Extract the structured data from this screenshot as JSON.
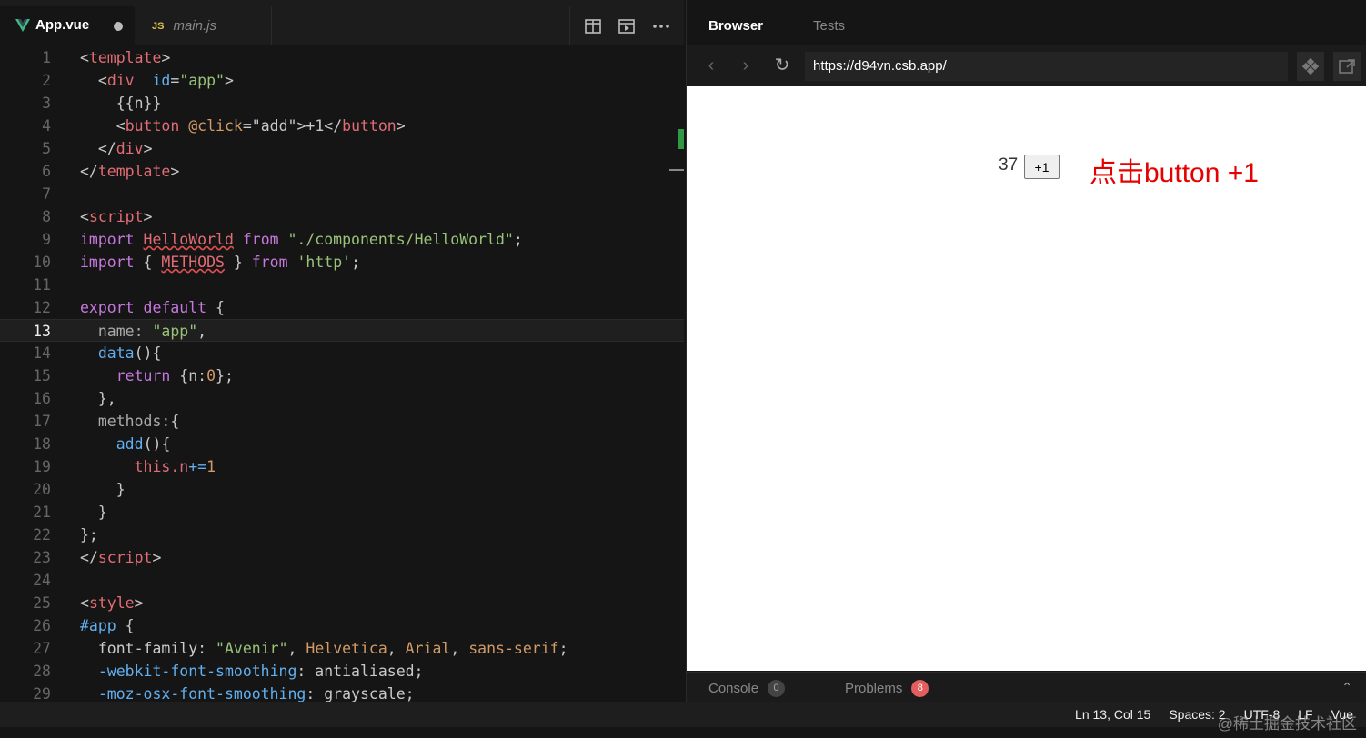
{
  "editor": {
    "tabs": [
      {
        "label": "App.vue",
        "icon": "vue-logo-icon",
        "modified": true
      },
      {
        "label": "main.js",
        "badge": "JS"
      }
    ],
    "actions": [
      "split-editor-icon",
      "preview-icon",
      "more-icon"
    ],
    "current_line": 13,
    "lines": [
      {
        "n": "1"
      },
      {
        "n": "2"
      },
      {
        "n": "3"
      },
      {
        "n": "4"
      },
      {
        "n": "5"
      },
      {
        "n": "6"
      },
      {
        "n": "7"
      },
      {
        "n": "8"
      },
      {
        "n": "9"
      },
      {
        "n": "10"
      },
      {
        "n": "11"
      },
      {
        "n": "12"
      },
      {
        "n": "13"
      },
      {
        "n": "14"
      },
      {
        "n": "15"
      },
      {
        "n": "16"
      },
      {
        "n": "17"
      },
      {
        "n": "18"
      },
      {
        "n": "19"
      },
      {
        "n": "20"
      },
      {
        "n": "21"
      },
      {
        "n": "22"
      },
      {
        "n": "23"
      },
      {
        "n": "24"
      },
      {
        "n": "25"
      },
      {
        "n": "26"
      },
      {
        "n": "27"
      },
      {
        "n": "28"
      },
      {
        "n": "29"
      }
    ],
    "code": [
      [
        [
          "t-br",
          "<"
        ],
        [
          "t-tag",
          "template"
        ],
        [
          "t-br",
          ">"
        ]
      ],
      [
        [
          "",
          "  "
        ],
        [
          "t-br",
          "<"
        ],
        [
          "t-tag",
          "div"
        ],
        [
          "",
          "",
          " "
        ],
        [
          "t-attr",
          " id"
        ],
        [
          "t-br",
          "="
        ],
        [
          "t-str",
          "\"app\""
        ],
        [
          "t-br",
          ">"
        ]
      ],
      [
        [
          "",
          "    {{n}}"
        ]
      ],
      [
        [
          "",
          "    "
        ],
        [
          "t-br",
          "<"
        ],
        [
          "t-tag",
          "button"
        ],
        [
          "t-num",
          " @click"
        ],
        [
          "t-br",
          "="
        ],
        [
          "",
          "\"add\""
        ],
        [
          "t-br",
          ">"
        ],
        [
          "",
          "+1"
        ],
        [
          "t-br",
          "</"
        ],
        [
          "t-tag",
          "button"
        ],
        [
          "t-br",
          ">"
        ]
      ],
      [
        [
          "",
          "  "
        ],
        [
          "t-br",
          "</"
        ],
        [
          "t-tag",
          "div"
        ],
        [
          "t-br",
          ">"
        ]
      ],
      [
        [
          "t-br",
          "</"
        ],
        [
          "t-tag",
          "template"
        ],
        [
          "t-br",
          ">"
        ]
      ],
      [],
      [
        [
          "t-br",
          "<"
        ],
        [
          "t-tag",
          "script"
        ],
        [
          "t-br",
          ">"
        ]
      ],
      [
        [
          "t-kw",
          "import "
        ],
        [
          "t-err",
          "HelloWorld"
        ],
        [
          "t-kw",
          " from "
        ],
        [
          "t-str",
          "\"./components/HelloWorld\""
        ],
        [
          "",
          ";"
        ]
      ],
      [
        [
          "t-kw",
          "import "
        ],
        [
          "",
          "{ "
        ],
        [
          "t-err",
          "METHODS"
        ],
        [
          "",
          " } "
        ],
        [
          "t-kw",
          "from "
        ],
        [
          "t-str",
          "'http'"
        ],
        [
          "",
          ";"
        ]
      ],
      [],
      [
        [
          "t-kw",
          "export default "
        ],
        [
          "",
          "{"
        ]
      ],
      [
        [
          "",
          "  "
        ],
        [
          "t-prop",
          "name: "
        ],
        [
          "t-str",
          "\"app\""
        ],
        [
          "",
          ","
        ]
      ],
      [
        [
          "",
          "  "
        ],
        [
          "t-fn",
          "data"
        ],
        [
          "",
          "(){"
        ]
      ],
      [
        [
          "",
          "    "
        ],
        [
          "t-kw",
          "return "
        ],
        [
          "",
          "{n:"
        ],
        [
          "t-num",
          "0"
        ],
        [
          "",
          "};"
        ]
      ],
      [
        [
          "",
          "  },"
        ]
      ],
      [
        [
          "",
          "  "
        ],
        [
          "t-prop",
          "methods:"
        ],
        [
          "",
          "{"
        ]
      ],
      [
        [
          "",
          "    "
        ],
        [
          "t-fn",
          "add"
        ],
        [
          "",
          "(){"
        ]
      ],
      [
        [
          "",
          "      "
        ],
        [
          "t-this",
          "this"
        ],
        [
          "t-this",
          ".n"
        ],
        [
          "t-fn",
          "+="
        ],
        [
          "t-num",
          "1"
        ]
      ],
      [
        [
          "",
          "    }"
        ]
      ],
      [
        [
          "",
          "  }"
        ]
      ],
      [
        [
          "",
          "};"
        ]
      ],
      [
        [
          "t-br",
          "</"
        ],
        [
          "t-tag",
          "script"
        ],
        [
          "t-br",
          ">"
        ]
      ],
      [],
      [
        [
          "t-br",
          "<"
        ],
        [
          "t-tag",
          "style"
        ],
        [
          "t-br",
          ">"
        ]
      ],
      [
        [
          "t-sel",
          "#app "
        ],
        [
          "",
          "{"
        ]
      ],
      [
        [
          "",
          "  "
        ],
        [
          "t-cssprop",
          "font-family"
        ],
        [
          "",
          ": "
        ],
        [
          "t-str",
          "\"Avenir\""
        ],
        [
          "",
          ", "
        ],
        [
          "t-val",
          "Helvetica"
        ],
        [
          "",
          ", "
        ],
        [
          "t-val",
          "Arial"
        ],
        [
          "",
          ", "
        ],
        [
          "t-val",
          "sans-serif"
        ],
        [
          "",
          ";"
        ]
      ],
      [
        [
          "",
          "  "
        ],
        [
          "t-attr",
          "-webkit-font-smoothing"
        ],
        [
          "",
          ": antialiased;"
        ]
      ],
      [
        [
          "",
          "  "
        ],
        [
          "t-attr",
          "-moz-osx-font-smoothing"
        ],
        [
          "",
          ": grayscale;"
        ]
      ]
    ]
  },
  "browser": {
    "tabs": {
      "active": "Browser",
      "inactive": "Tests"
    },
    "url": "https://d94vn.csb.app/",
    "content": {
      "count": "37",
      "button_label": "+1",
      "annotation": "点击button +1"
    },
    "bottom": {
      "console_label": "Console",
      "console_count": "0",
      "problems_label": "Problems",
      "problems_count": "8"
    }
  },
  "status": {
    "position": "Ln 13, Col 15",
    "spaces": "Spaces: 2",
    "encoding": "UTF-8",
    "eol": "LF",
    "language": "Vue"
  },
  "watermark": "@稀土掘金技术社区",
  "colors": {
    "accent_green": "#2f9a45",
    "error_red": "#e35e5e",
    "annotation_red": "#e60000"
  }
}
